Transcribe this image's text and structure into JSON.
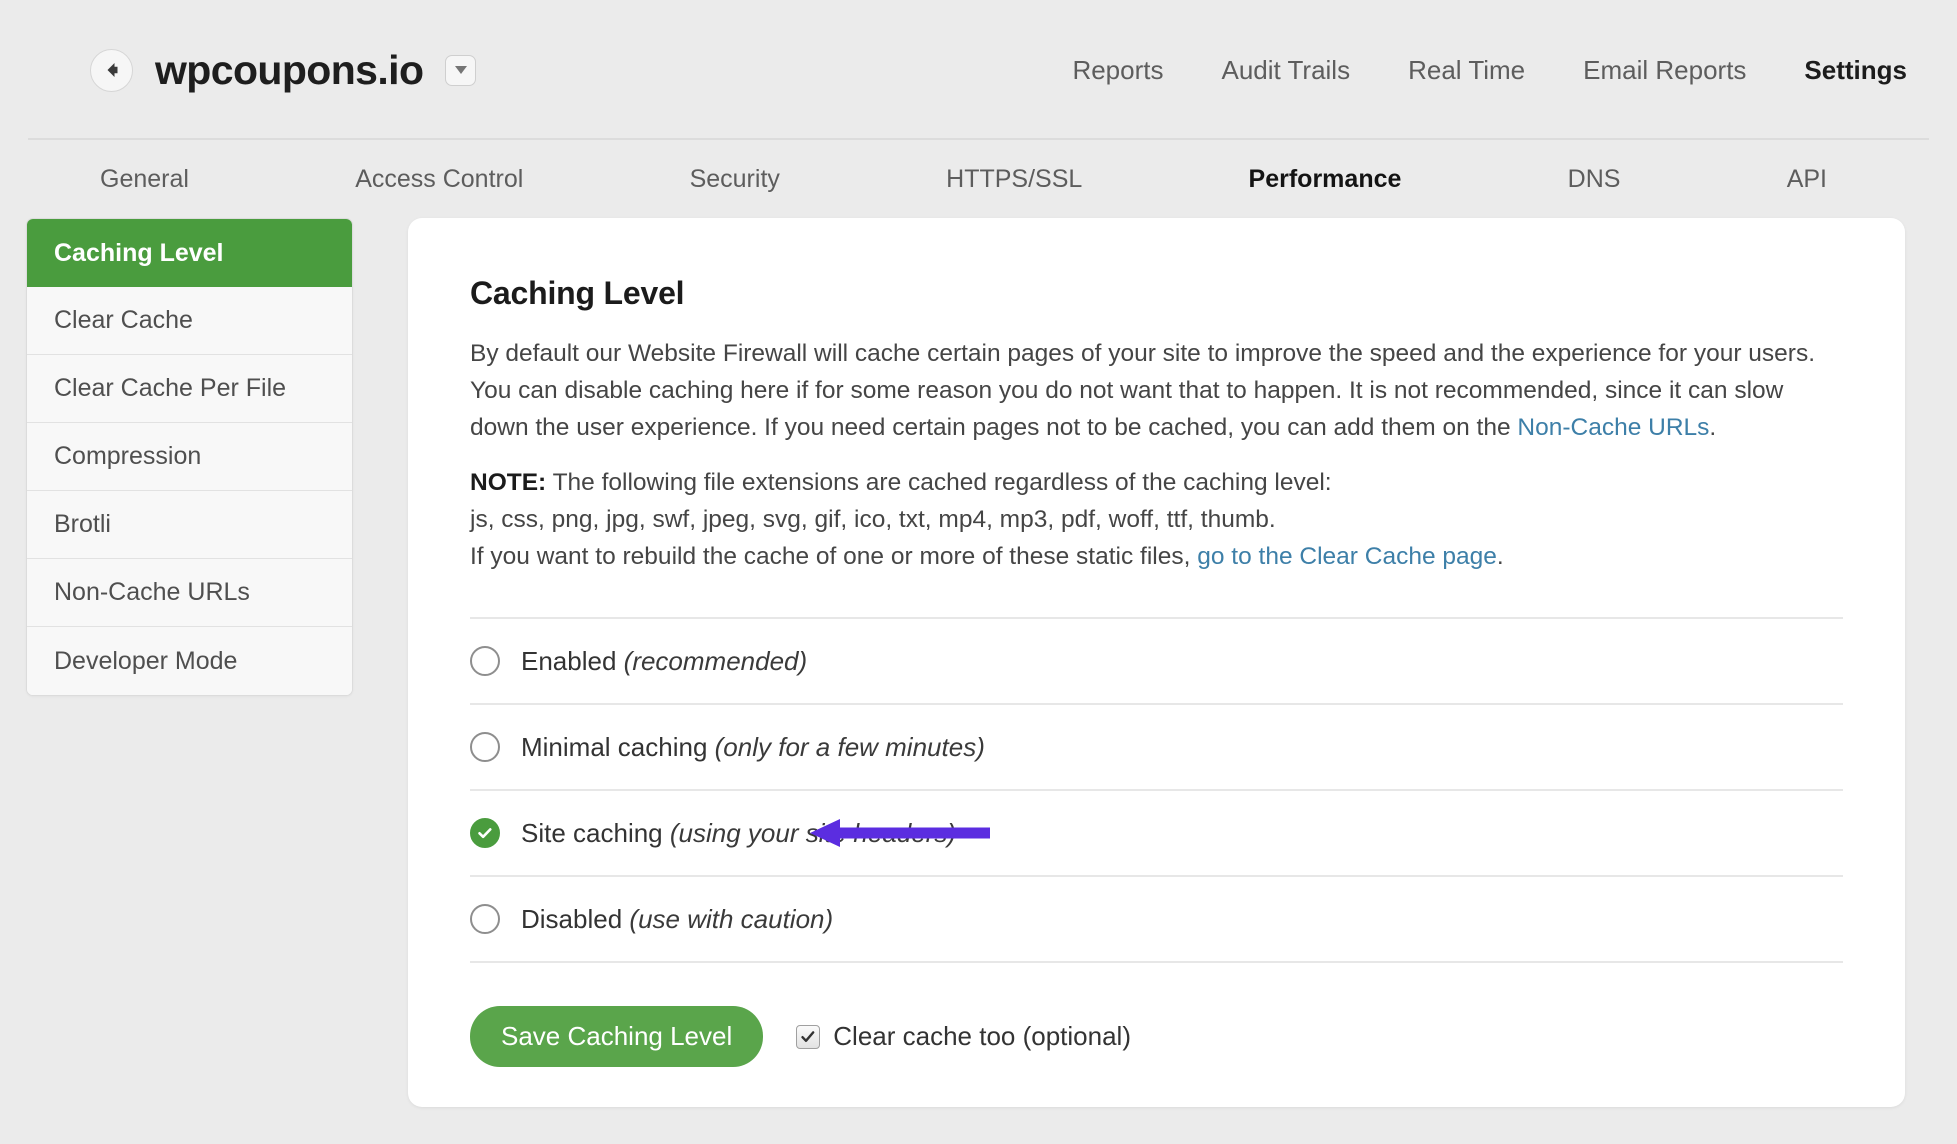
{
  "header": {
    "back_icon": "arrow-left-circle-icon",
    "site_title": "wpcoupons.io",
    "site_dropdown_icon": "chevron-down-icon",
    "nav": [
      {
        "label": "Reports",
        "active": false
      },
      {
        "label": "Audit Trails",
        "active": false
      },
      {
        "label": "Real Time",
        "active": false
      },
      {
        "label": "Email Reports",
        "active": false
      },
      {
        "label": "Settings",
        "active": true
      }
    ]
  },
  "subtabs": [
    {
      "label": "General",
      "active": false
    },
    {
      "label": "Access Control",
      "active": false
    },
    {
      "label": "Security",
      "active": false
    },
    {
      "label": "HTTPS/SSL",
      "active": false
    },
    {
      "label": "Performance",
      "active": true
    },
    {
      "label": "DNS",
      "active": false
    },
    {
      "label": "API",
      "active": false
    }
  ],
  "sidebar": {
    "items": [
      {
        "label": "Caching Level",
        "active": true
      },
      {
        "label": "Clear Cache",
        "active": false
      },
      {
        "label": "Clear Cache Per File",
        "active": false
      },
      {
        "label": "Compression",
        "active": false
      },
      {
        "label": "Brotli",
        "active": false
      },
      {
        "label": "Non-Cache URLs",
        "active": false
      },
      {
        "label": "Developer Mode",
        "active": false
      }
    ]
  },
  "panel": {
    "title": "Caching Level",
    "description_part1": "By default our Website Firewall will cache certain pages of your site to improve the speed and the experience for your users. You can disable caching here if for some reason you do not want that to happen. It is not recommended, since it can slow down the user experience. If you need certain pages not to be cached, you can add them on the ",
    "description_link": "Non-Cache URLs",
    "description_part2": ".",
    "note_label": "NOTE:",
    "note_line1": " The following file extensions are cached regardless of the caching level:",
    "note_line2": "js, css, png, jpg, swf, jpeg, svg, gif, ico, txt, mp4, mp3, pdf, woff, ttf, thumb.",
    "note_line3_prefix": "If you want to rebuild the cache of one or more of these static files, ",
    "note_line3_link": "go to the Clear Cache page",
    "note_line3_suffix": ".",
    "options": [
      {
        "label": "Enabled ",
        "hint": "(recommended)",
        "checked": false
      },
      {
        "label": "Minimal caching ",
        "hint": "(only for a few minutes)",
        "checked": false
      },
      {
        "label": "Site caching ",
        "hint": "(using your site headers)",
        "checked": true
      },
      {
        "label": "Disabled ",
        "hint": "(use with caution)",
        "checked": false
      }
    ],
    "save_label": "Save Caching Level",
    "clear_cache_label": "Clear cache too (optional)",
    "clear_cache_checked": true,
    "annotation_arrow": "left-arrow-annotation"
  },
  "colors": {
    "accent_green": "#4a9c3e",
    "button_green": "#5aa54b",
    "link_blue": "#3d7fa8",
    "annotation_purple": "#5b2de0",
    "page_background": "#ebebeb"
  }
}
